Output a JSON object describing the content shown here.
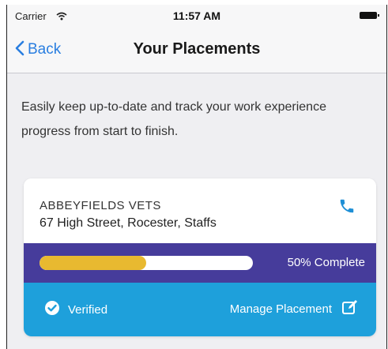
{
  "status_bar": {
    "carrier": "Carrier",
    "time": "11:57 AM"
  },
  "nav": {
    "back_label": "Back",
    "title": "Your Placements"
  },
  "intro_text": "Easily keep up-to-date and track your work experience progress from start to finish.",
  "placement": {
    "name": "ABBEYFIELDS VETS",
    "address": "67 High Street, Rocester, Staffs",
    "progress_percent": 50,
    "progress_label": "50% Complete",
    "status": "Verified",
    "manage_label": "Manage Placement"
  },
  "colors": {
    "accent_blue": "#2a7ee0",
    "progress_band": "#463c9b",
    "progress_fill": "#e8b930",
    "action_band": "#1ea0db"
  },
  "icons": [
    "wifi-icon",
    "battery-icon",
    "chevron-left-icon",
    "phone-icon",
    "check-circle-icon",
    "edit-icon"
  ]
}
